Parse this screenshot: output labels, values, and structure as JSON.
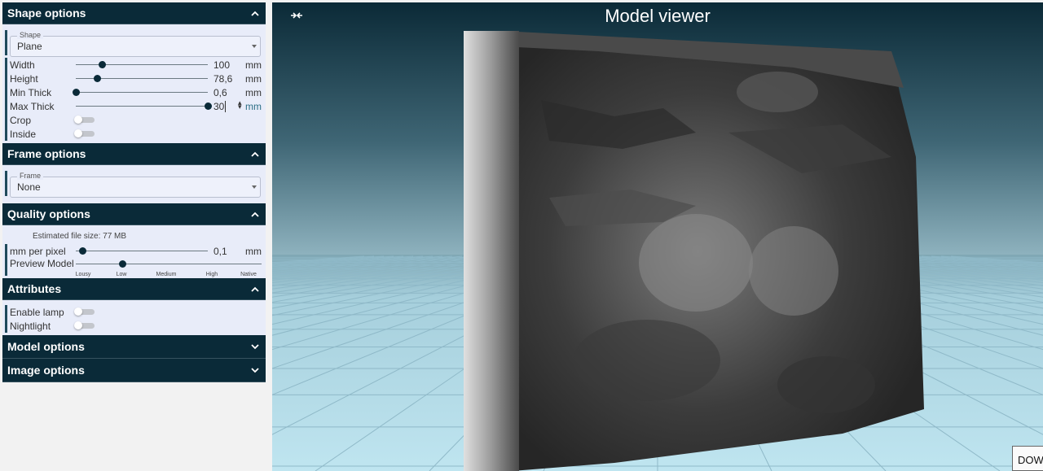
{
  "sections": {
    "shape": {
      "title": "Shape options"
    },
    "frame": {
      "title": "Frame options"
    },
    "quality": {
      "title": "Quality options"
    },
    "attributes": {
      "title": "Attributes"
    },
    "model": {
      "title": "Model options"
    },
    "image": {
      "title": "Image options"
    }
  },
  "shape": {
    "shape_select": {
      "legend": "Shape",
      "value": "Plane"
    },
    "width": {
      "label": "Width",
      "value": "100",
      "unit": "mm",
      "fraction": 0.2
    },
    "height": {
      "label": "Height",
      "value": "78,6",
      "unit": "mm",
      "fraction": 0.16
    },
    "min_thick": {
      "label": "Min Thick",
      "value": "0,6",
      "unit": "mm",
      "fraction": 0.0
    },
    "max_thick": {
      "label": "Max Thick",
      "value": "30",
      "unit": "mm",
      "fraction": 1.0
    },
    "crop": {
      "label": "Crop",
      "on": false
    },
    "inside": {
      "label": "Inside",
      "on": false
    }
  },
  "frame": {
    "frame_select": {
      "legend": "Frame",
      "value": "None"
    }
  },
  "quality": {
    "estimated_size": "Estimated file size: 77 MB",
    "mm_per_pixel": {
      "label": "mm per pixel",
      "value": "0,1",
      "unit": "mm",
      "fraction": 0.05
    },
    "preview_model": {
      "label": "Preview Model",
      "fraction": 0.25,
      "ticks": [
        "Lousy",
        "Low",
        "Medium",
        "High",
        "Native"
      ]
    }
  },
  "attributes": {
    "enable_lamp": {
      "label": "Enable lamp",
      "on": false
    },
    "nightlight": {
      "label": "Nightlight",
      "on": false
    }
  },
  "viewer": {
    "title": "Model viewer",
    "download_label": "DOWNLOAD",
    "colors": {
      "sky": "#0b2a37",
      "floor": "#b7dde9",
      "grid": "#8fb9c8"
    }
  },
  "colors": {
    "header_bg": "#0a2a38",
    "panel_bg": "#e8ecf9",
    "accent": "#1f4a5b"
  }
}
